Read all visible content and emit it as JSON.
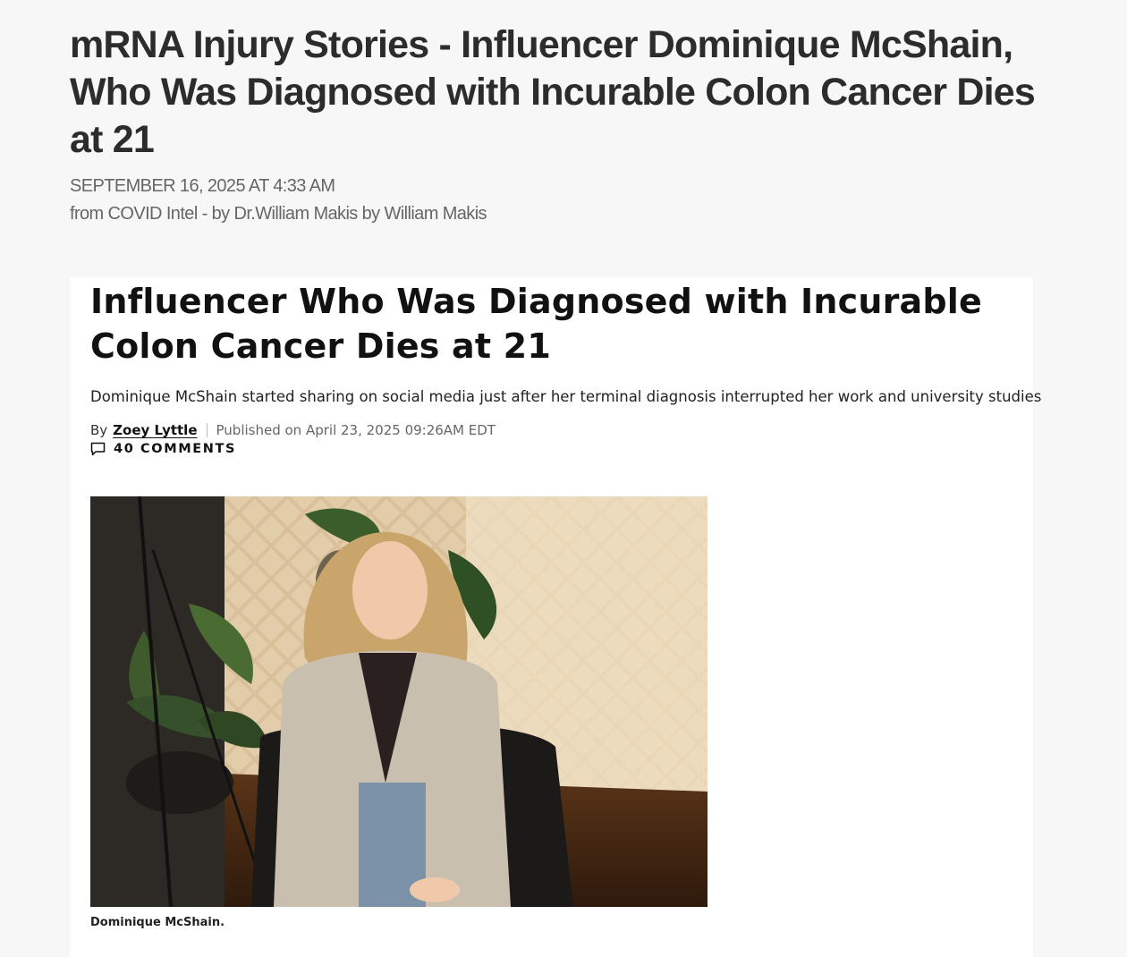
{
  "post": {
    "title": "mRNA Injury Stories - Influencer Dominique McShain, Who Was Diagnosed with Incurable Colon Cancer Dies at 21",
    "date": "SEPTEMBER 16, 2025 AT 4:33 AM",
    "source": "from COVID Intel - by Dr.William Makis by William Makis"
  },
  "embed": {
    "headline": "Influencer Who Was Diagnosed with Incurable Colon Cancer Dies at 21",
    "dek": "Dominique McShain started sharing on social media just after her terminal diagnosis interrupted her work and university studies",
    "byline_prefix": "By",
    "author": "Zoey Lyttle",
    "published": "Published on April 23, 2025 09:26AM EDT",
    "comments": "40 COMMENTS",
    "caption": "Dominique McShain.",
    "icons": {
      "comment": "comment-icon"
    }
  }
}
